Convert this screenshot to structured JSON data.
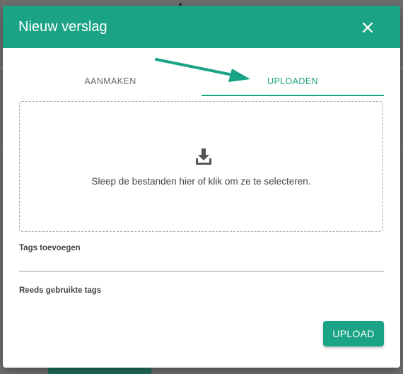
{
  "dialog": {
    "title": "Nieuw verslag",
    "close_icon": "close-icon"
  },
  "tabs": [
    {
      "label": "AANMAKEN",
      "active": false
    },
    {
      "label": "UPLOADEN",
      "active": true
    }
  ],
  "annotation": {
    "icon": "arrow-icon",
    "color": "#1aa385"
  },
  "dropzone": {
    "icon": "download-icon",
    "text": "Sleep de bestanden hier of klik om ze te selecteren."
  },
  "tags": {
    "label": "Tags toevoegen",
    "value": "",
    "placeholder": ""
  },
  "used_tags": {
    "label": "Reeds gebruikte tags"
  },
  "actions": {
    "upload_label": "UPLOAD"
  },
  "colors": {
    "accent": "#1aa385",
    "header_text": "#ffffff",
    "backdrop": "#6f6f6f"
  }
}
